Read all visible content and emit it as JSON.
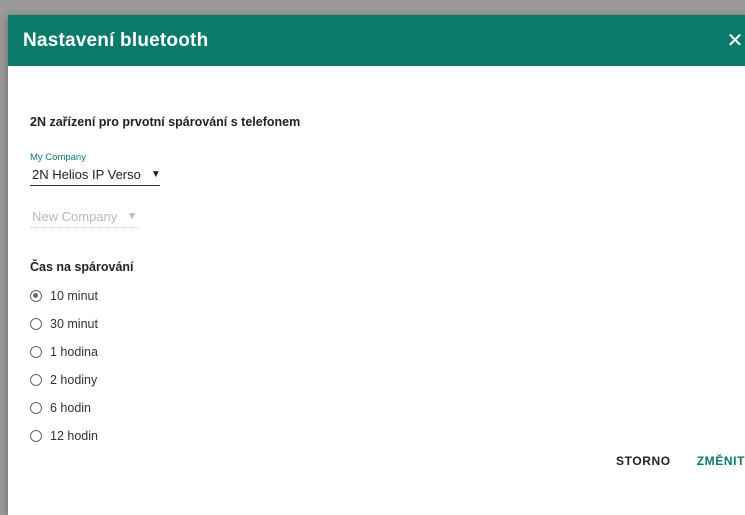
{
  "dialog": {
    "title": "Nastavení bluetooth",
    "close_icon": "close-icon"
  },
  "pairing": {
    "section_title": "2N zařízení pro prvotní spárování s telefonem",
    "company_label": "My Company",
    "device_value": "2N Helios IP Verso",
    "new_company_placeholder": "New Company"
  },
  "time": {
    "section_title": "Čas na spárování",
    "options": [
      "10 minut",
      "30 minut",
      "1 hodina",
      "2 hodiny",
      "6 hodin",
      "12 hodin"
    ],
    "selected_index": 0
  },
  "actions": {
    "cancel_label": "STORNO",
    "confirm_label": "ZMĚNIT"
  },
  "colors": {
    "accent": "#0a7a6a"
  }
}
